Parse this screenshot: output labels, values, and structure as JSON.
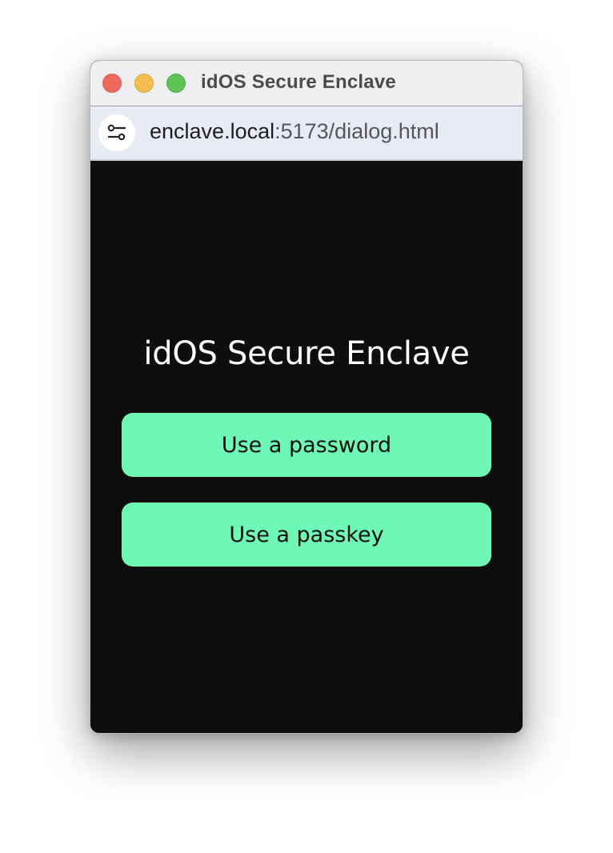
{
  "window": {
    "title": "idOS Secure Enclave"
  },
  "address_bar": {
    "url_host": "enclave.local",
    "url_rest": ":5173/dialog.html",
    "settings_icon": "site-settings-icon"
  },
  "dialog": {
    "heading": "idOS Secure Enclave",
    "password_button": "Use a password",
    "passkey_button": "Use a passkey"
  },
  "colors": {
    "accent": "#6ef8b5",
    "background": "#0e0e0e",
    "traffic_close": "#ed6a5e",
    "traffic_minimize": "#f4bf4f",
    "traffic_maximize": "#61c554"
  }
}
